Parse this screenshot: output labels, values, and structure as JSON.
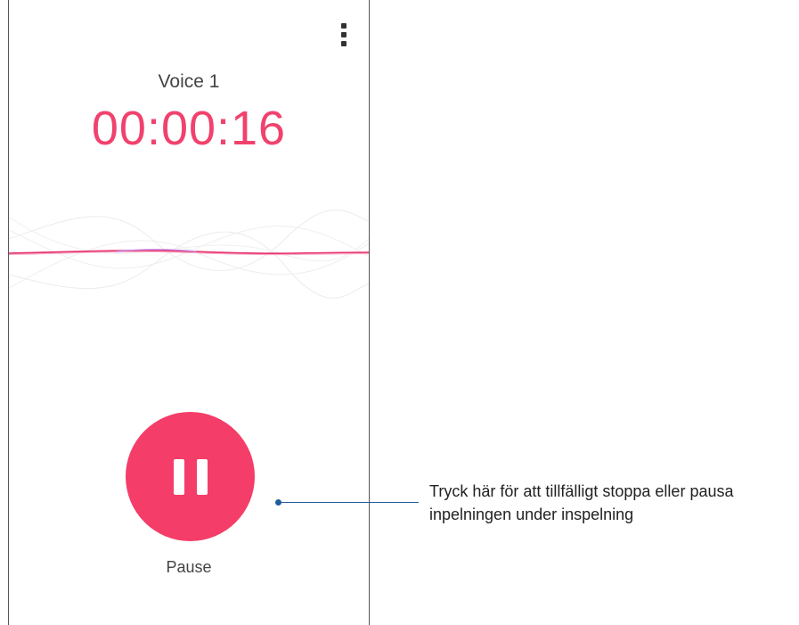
{
  "recording": {
    "title": "Voice 1",
    "timer": "00:00:16"
  },
  "controls": {
    "pause_label": "Pause",
    "pause_icon": "pause-icon",
    "menu_icon": "more-vertical-icon"
  },
  "annotation": {
    "text": "Tryck här för att tillfälligt stoppa eller pausa inpelningen under inspelning"
  },
  "colors": {
    "accent": "#f43d68",
    "timer": "#f0426d",
    "callout": "#1f5d9c"
  }
}
